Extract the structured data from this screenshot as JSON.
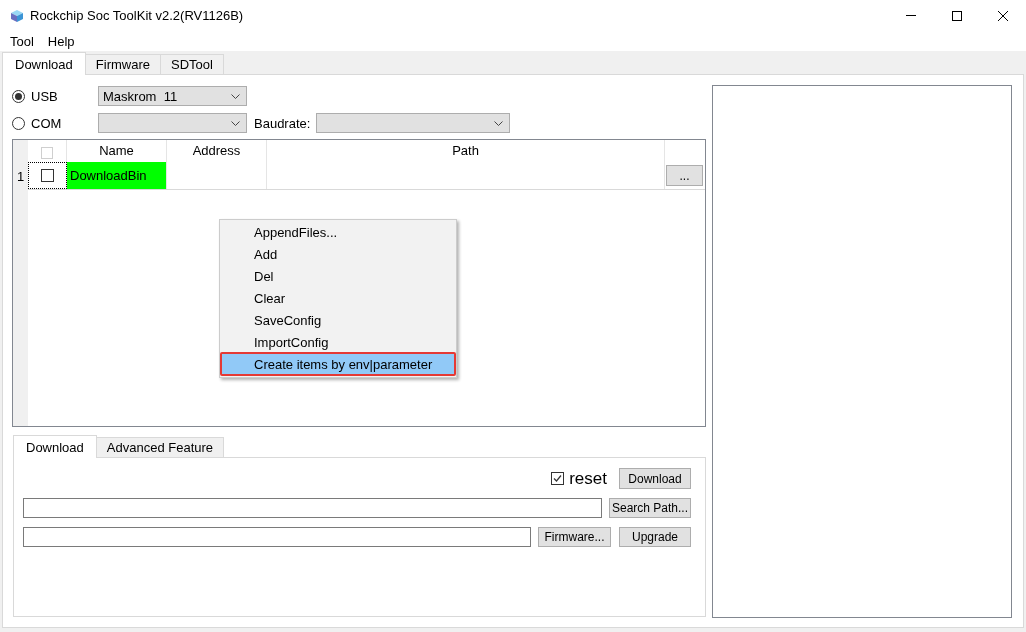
{
  "window": {
    "title": "Rockchip Soc ToolKit v2.2(RV1126B)"
  },
  "menu_bar": [
    "Tool",
    "Help"
  ],
  "tabs": [
    {
      "label": "Download",
      "selected": true
    },
    {
      "label": "Firmware",
      "selected": false
    },
    {
      "label": "SDTool",
      "selected": false
    }
  ],
  "connection": {
    "options": [
      {
        "label": "USB",
        "selected": true,
        "device": "Maskrom  11"
      },
      {
        "label": "COM",
        "selected": false,
        "baudrate_label": "Baudrate:"
      }
    ]
  },
  "table": {
    "select_all": {
      "checked": false,
      "disabled": true
    },
    "columns": [
      "Name",
      "Address",
      "Path"
    ],
    "rows": [
      {
        "number": "1",
        "checked": false,
        "focused": true,
        "name": "DownloadBin",
        "color": "#00ff00",
        "browse": "..."
      }
    ]
  },
  "context_menu": {
    "items": [
      {
        "label": "AppendFiles...",
        "selected": false,
        "annotated": false
      },
      {
        "label": "Add",
        "selected": false,
        "annotated": false
      },
      {
        "label": "Del",
        "selected": false,
        "annotated": false
      },
      {
        "label": "Clear",
        "selected": false,
        "annotated": false
      },
      {
        "label": "SaveConfig",
        "selected": false,
        "annotated": false
      },
      {
        "label": "ImportConfig",
        "selected": false,
        "annotated": false
      },
      {
        "label": "Create items by env|parameter",
        "selected": true,
        "annotated": true
      }
    ]
  },
  "bottom_tabs": [
    {
      "label": "Download",
      "selected": true
    },
    {
      "label": "Advanced Feature",
      "selected": false
    }
  ],
  "download_panel": {
    "reset": {
      "label": "reset",
      "checked": true
    },
    "download_button": "Download",
    "search_path_button": "Search Path...",
    "firmware_button": "Firmware...",
    "upgrade_button": "Upgrade"
  }
}
